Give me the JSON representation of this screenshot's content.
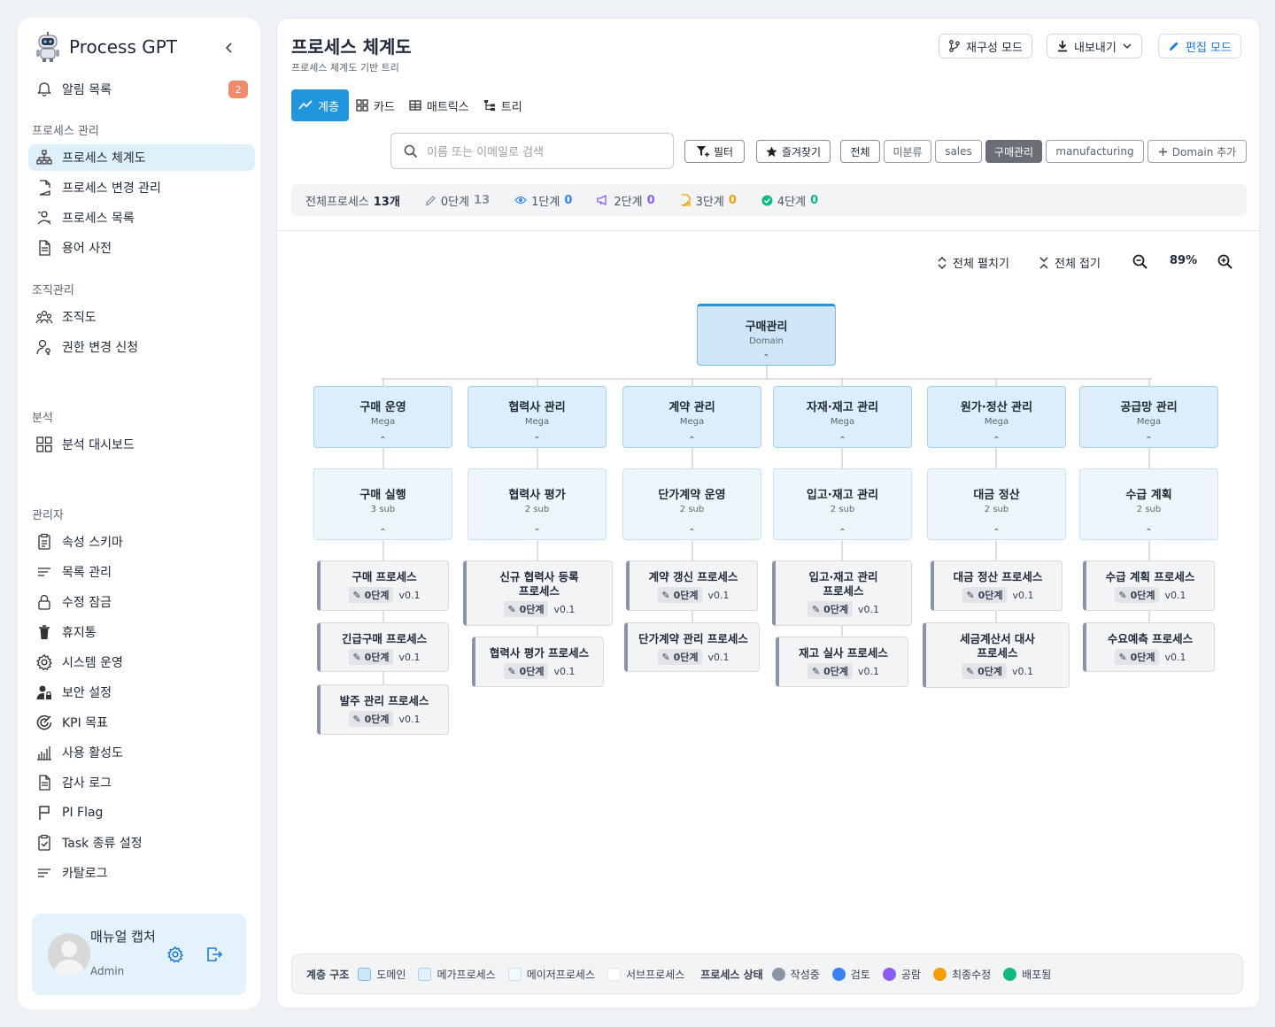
{
  "sidebar": {
    "brand": "Process GPT",
    "notifications": {
      "label": "알림 목록",
      "count": "2"
    },
    "sections": [
      {
        "title": "프로세스 관리",
        "items": [
          {
            "label": "프로세스 체계도",
            "icon": "sitemap-icon",
            "active": true
          },
          {
            "label": "프로세스 변경 관리",
            "icon": "file-edit-icon"
          },
          {
            "label": "프로세스 목록",
            "icon": "process-list-icon"
          },
          {
            "label": "용어 사전",
            "icon": "document-icon"
          }
        ]
      },
      {
        "title": "조직관리",
        "items": [
          {
            "label": "조직도",
            "icon": "people-icon"
          },
          {
            "label": "권한 변경 신청",
            "icon": "user-key-icon"
          }
        ]
      },
      {
        "title": "분석",
        "items": [
          {
            "label": "분석 대시보드",
            "icon": "dashboard-icon"
          }
        ]
      },
      {
        "title": "관리자",
        "items": [
          {
            "label": "속성 스키마",
            "icon": "clipboard-icon"
          },
          {
            "label": "목록 관리",
            "icon": "list-icon"
          },
          {
            "label": "수정 잠금",
            "icon": "lock-icon"
          },
          {
            "label": "휴지통",
            "icon": "trash-icon"
          },
          {
            "label": "시스템 운영",
            "icon": "gear-icon"
          },
          {
            "label": "보안 설정",
            "icon": "user-lock-icon"
          },
          {
            "label": "KPI 목표",
            "icon": "target-icon"
          },
          {
            "label": "사용 활성도",
            "icon": "bar-chart-icon"
          },
          {
            "label": "감사 로그",
            "icon": "document-icon"
          },
          {
            "label": "PI Flag",
            "icon": "flag-icon"
          },
          {
            "label": "Task 종류 설정",
            "icon": "clipboard-check-icon"
          },
          {
            "label": "카탈로그",
            "icon": "list-icon"
          }
        ]
      }
    ],
    "user": {
      "name": "매뉴얼 캡처",
      "role": "Admin"
    }
  },
  "header": {
    "title": "프로세스 체계도",
    "subtitle": "프로세스 체계도 기반 트리",
    "buttons": {
      "restructure": "재구성 모드",
      "export": "내보내기",
      "edit": "편집 모드"
    }
  },
  "view_tabs": [
    "계층",
    "카드",
    "매트릭스",
    "트리"
  ],
  "search": {
    "placeholder": "이름 또는 이메일로 검색"
  },
  "filters": {
    "filter": "필터",
    "favorites": "즐겨찾기",
    "domains": [
      "전체",
      "미분류",
      "sales",
      "구매관리",
      "manufacturing"
    ],
    "add_domain": "Domain 추가"
  },
  "stats": {
    "total_label": "전체프로세스",
    "total": "13개",
    "stages": [
      {
        "label": "0단계",
        "value": "13",
        "color": "#8b94a6"
      },
      {
        "label": "1단계",
        "value": "0",
        "color": "#3b82f6"
      },
      {
        "label": "2단계",
        "value": "0",
        "color": "#8b5cf6"
      },
      {
        "label": "3단계",
        "value": "0",
        "color": "#f59e0b"
      },
      {
        "label": "4단계",
        "value": "0",
        "color": "#10b981"
      }
    ]
  },
  "toolbar": {
    "expand_all": "전체 펼치기",
    "collapse_all": "전체 접기",
    "zoom": "89%"
  },
  "tree": {
    "domain": {
      "title": "구매관리",
      "sub": "Domain"
    },
    "megas": [
      {
        "title": "구매 운영",
        "sub": "Mega",
        "major": {
          "title": "구매 실행",
          "sub": "3 sub"
        },
        "procs": [
          [
            "구매 프로세스"
          ],
          [
            "긴급구매 프로세스"
          ],
          [
            "발주 관리 프로세스"
          ]
        ]
      },
      {
        "title": "협력사 관리",
        "sub": "Mega",
        "major": {
          "title": "협력사 평가",
          "sub": "2 sub"
        },
        "procs": [
          [
            "신규 협력사 등록",
            "프로세스"
          ],
          [
            "협력사 평가 프로세스"
          ]
        ]
      },
      {
        "title": "계약 관리",
        "sub": "Mega",
        "major": {
          "title": "단가계약 운영",
          "sub": "2 sub"
        },
        "procs": [
          [
            "계약 갱신 프로세스"
          ],
          [
            "단가계약 관리 프로세스"
          ]
        ]
      },
      {
        "title": "자재·재고 관리",
        "sub": "Mega",
        "major": {
          "title": "입고·재고 관리",
          "sub": "2 sub"
        },
        "procs": [
          [
            "입고·재고 관리",
            "프로세스"
          ],
          [
            "재고 실사 프로세스"
          ]
        ]
      },
      {
        "title": "원가·정산 관리",
        "sub": "Mega",
        "major": {
          "title": "대금 정산",
          "sub": "2 sub"
        },
        "procs": [
          [
            "대금 정산 프로세스"
          ],
          [
            "세금계산서 대사",
            "프로세스"
          ]
        ]
      },
      {
        "title": "공급망 관리",
        "sub": "Mega",
        "major": {
          "title": "수급 계획",
          "sub": "2 sub"
        },
        "procs": [
          [
            "수급 계획 프로세스"
          ],
          [
            "수요예측 프로세스"
          ]
        ]
      }
    ],
    "proc_stage": "0단계",
    "proc_version": "v0.1"
  },
  "legend": {
    "structure_label": "계층 구조",
    "structure": [
      {
        "label": "도메인",
        "color": "#cfe6f7",
        "border": "#7cbbe8"
      },
      {
        "label": "메가프로세스",
        "color": "#e3f1fb",
        "border": "#a9d1ef"
      },
      {
        "label": "메이저프로세스",
        "color": "#f3f9fd",
        "border": "#c8e1f3"
      },
      {
        "label": "서브프로세스",
        "color": "#ffffff",
        "border": "#e5e7eb"
      }
    ],
    "status_label": "프로세스 상태",
    "status": [
      {
        "label": "작성중",
        "color": "#8b94a6"
      },
      {
        "label": "검토",
        "color": "#3b82f6"
      },
      {
        "label": "공람",
        "color": "#8b5cf6"
      },
      {
        "label": "최종수정",
        "color": "#f59e0b"
      },
      {
        "label": "배포됨",
        "color": "#10b981"
      }
    ]
  }
}
